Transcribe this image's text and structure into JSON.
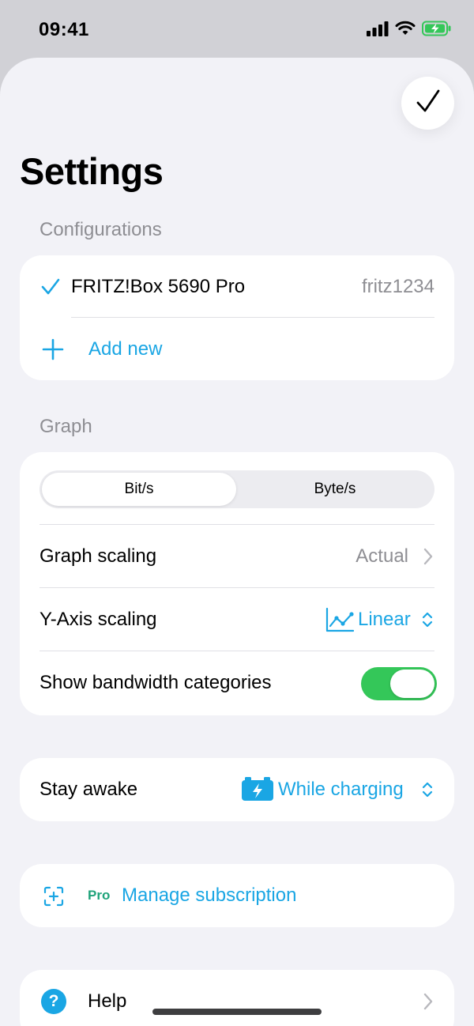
{
  "status_bar": {
    "time": "09:41"
  },
  "header": {
    "done_icon": "checkmark-icon",
    "title": "Settings"
  },
  "configurations": {
    "section_label": "Configurations",
    "items": [
      {
        "name": "FRITZ!Box 5690 Pro",
        "detail": "fritz1234",
        "selected": true
      }
    ],
    "add_label": "Add new"
  },
  "graph": {
    "section_label": "Graph",
    "units": {
      "options": [
        "Bit/s",
        "Byte/s"
      ],
      "selected": "Bit/s"
    },
    "scaling": {
      "label": "Graph scaling",
      "value": "Actual"
    },
    "y_axis": {
      "label": "Y-Axis scaling",
      "value": "Linear",
      "icon": "line-chart-icon"
    },
    "bandwidth": {
      "label": "Show bandwidth categories",
      "enabled": true
    }
  },
  "stay_awake": {
    "label": "Stay awake",
    "value": "While charging",
    "icon": "battery-charging-icon"
  },
  "subscription": {
    "badge": "Pro",
    "label": "Manage subscription",
    "icon": "add-frame-icon"
  },
  "help": {
    "label": "Help",
    "icon_glyph": "?"
  },
  "colors": {
    "accent": "#1aa6e4",
    "toggle_on": "#34c759",
    "pro_badge": "#1fa37a",
    "background": "#f2f2f7"
  }
}
